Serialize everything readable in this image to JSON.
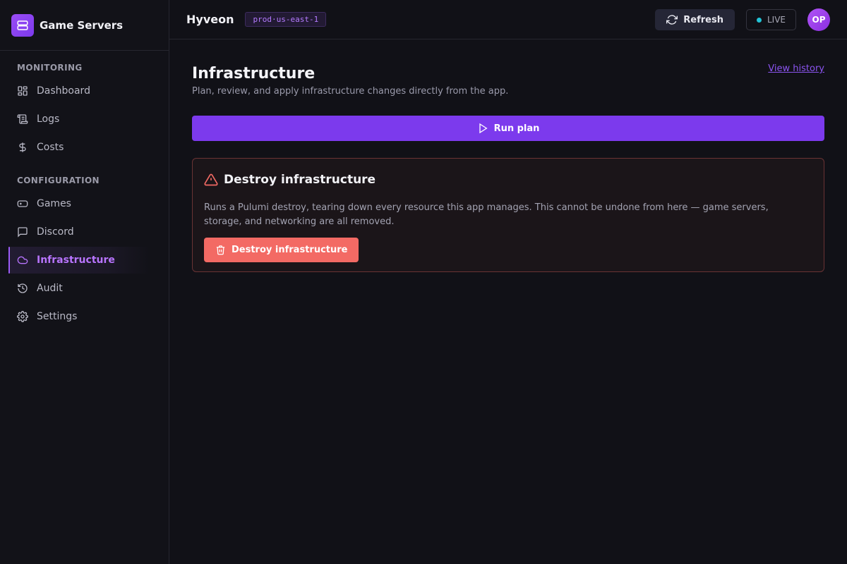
{
  "brand": {
    "name": "Game Servers",
    "logo_icon": "server-stack-icon",
    "accent": "#7c3aed"
  },
  "sidebar": {
    "sections": [
      {
        "heading": "MONITORING",
        "items": [
          {
            "label": "Dashboard",
            "icon": "dashboard-icon"
          },
          {
            "label": "Logs",
            "icon": "logs-icon"
          },
          {
            "label": "Costs",
            "icon": "dollar-icon"
          }
        ]
      },
      {
        "heading": "CONFIGURATION",
        "items": [
          {
            "label": "Games",
            "icon": "gamepad-icon"
          },
          {
            "label": "Discord",
            "icon": "chat-icon"
          },
          {
            "label": "Infrastructure",
            "icon": "cloud-icon",
            "active": true
          },
          {
            "label": "Audit",
            "icon": "history-icon"
          },
          {
            "label": "Settings",
            "icon": "gear-icon"
          }
        ]
      }
    ]
  },
  "header": {
    "project": "Hyveon",
    "environment": "prod·us-east-1",
    "refresh_label": "Refresh",
    "live_label": "LIVE",
    "live_color": "#22c3d6",
    "avatar_initials": "OP"
  },
  "main": {
    "title": "Infrastructure",
    "subtitle": "Plan, review, and apply infrastructure changes directly from the app.",
    "view_history": "View history",
    "run_plan_label": "Run plan",
    "danger": {
      "title": "Destroy infrastructure",
      "description": "Runs a Pulumi destroy, tearing down every resource this app manages. This cannot be undone from here — game servers, storage, and networking are all removed.",
      "button_label": "Destroy infrastructure",
      "color": "#f36a64"
    }
  }
}
